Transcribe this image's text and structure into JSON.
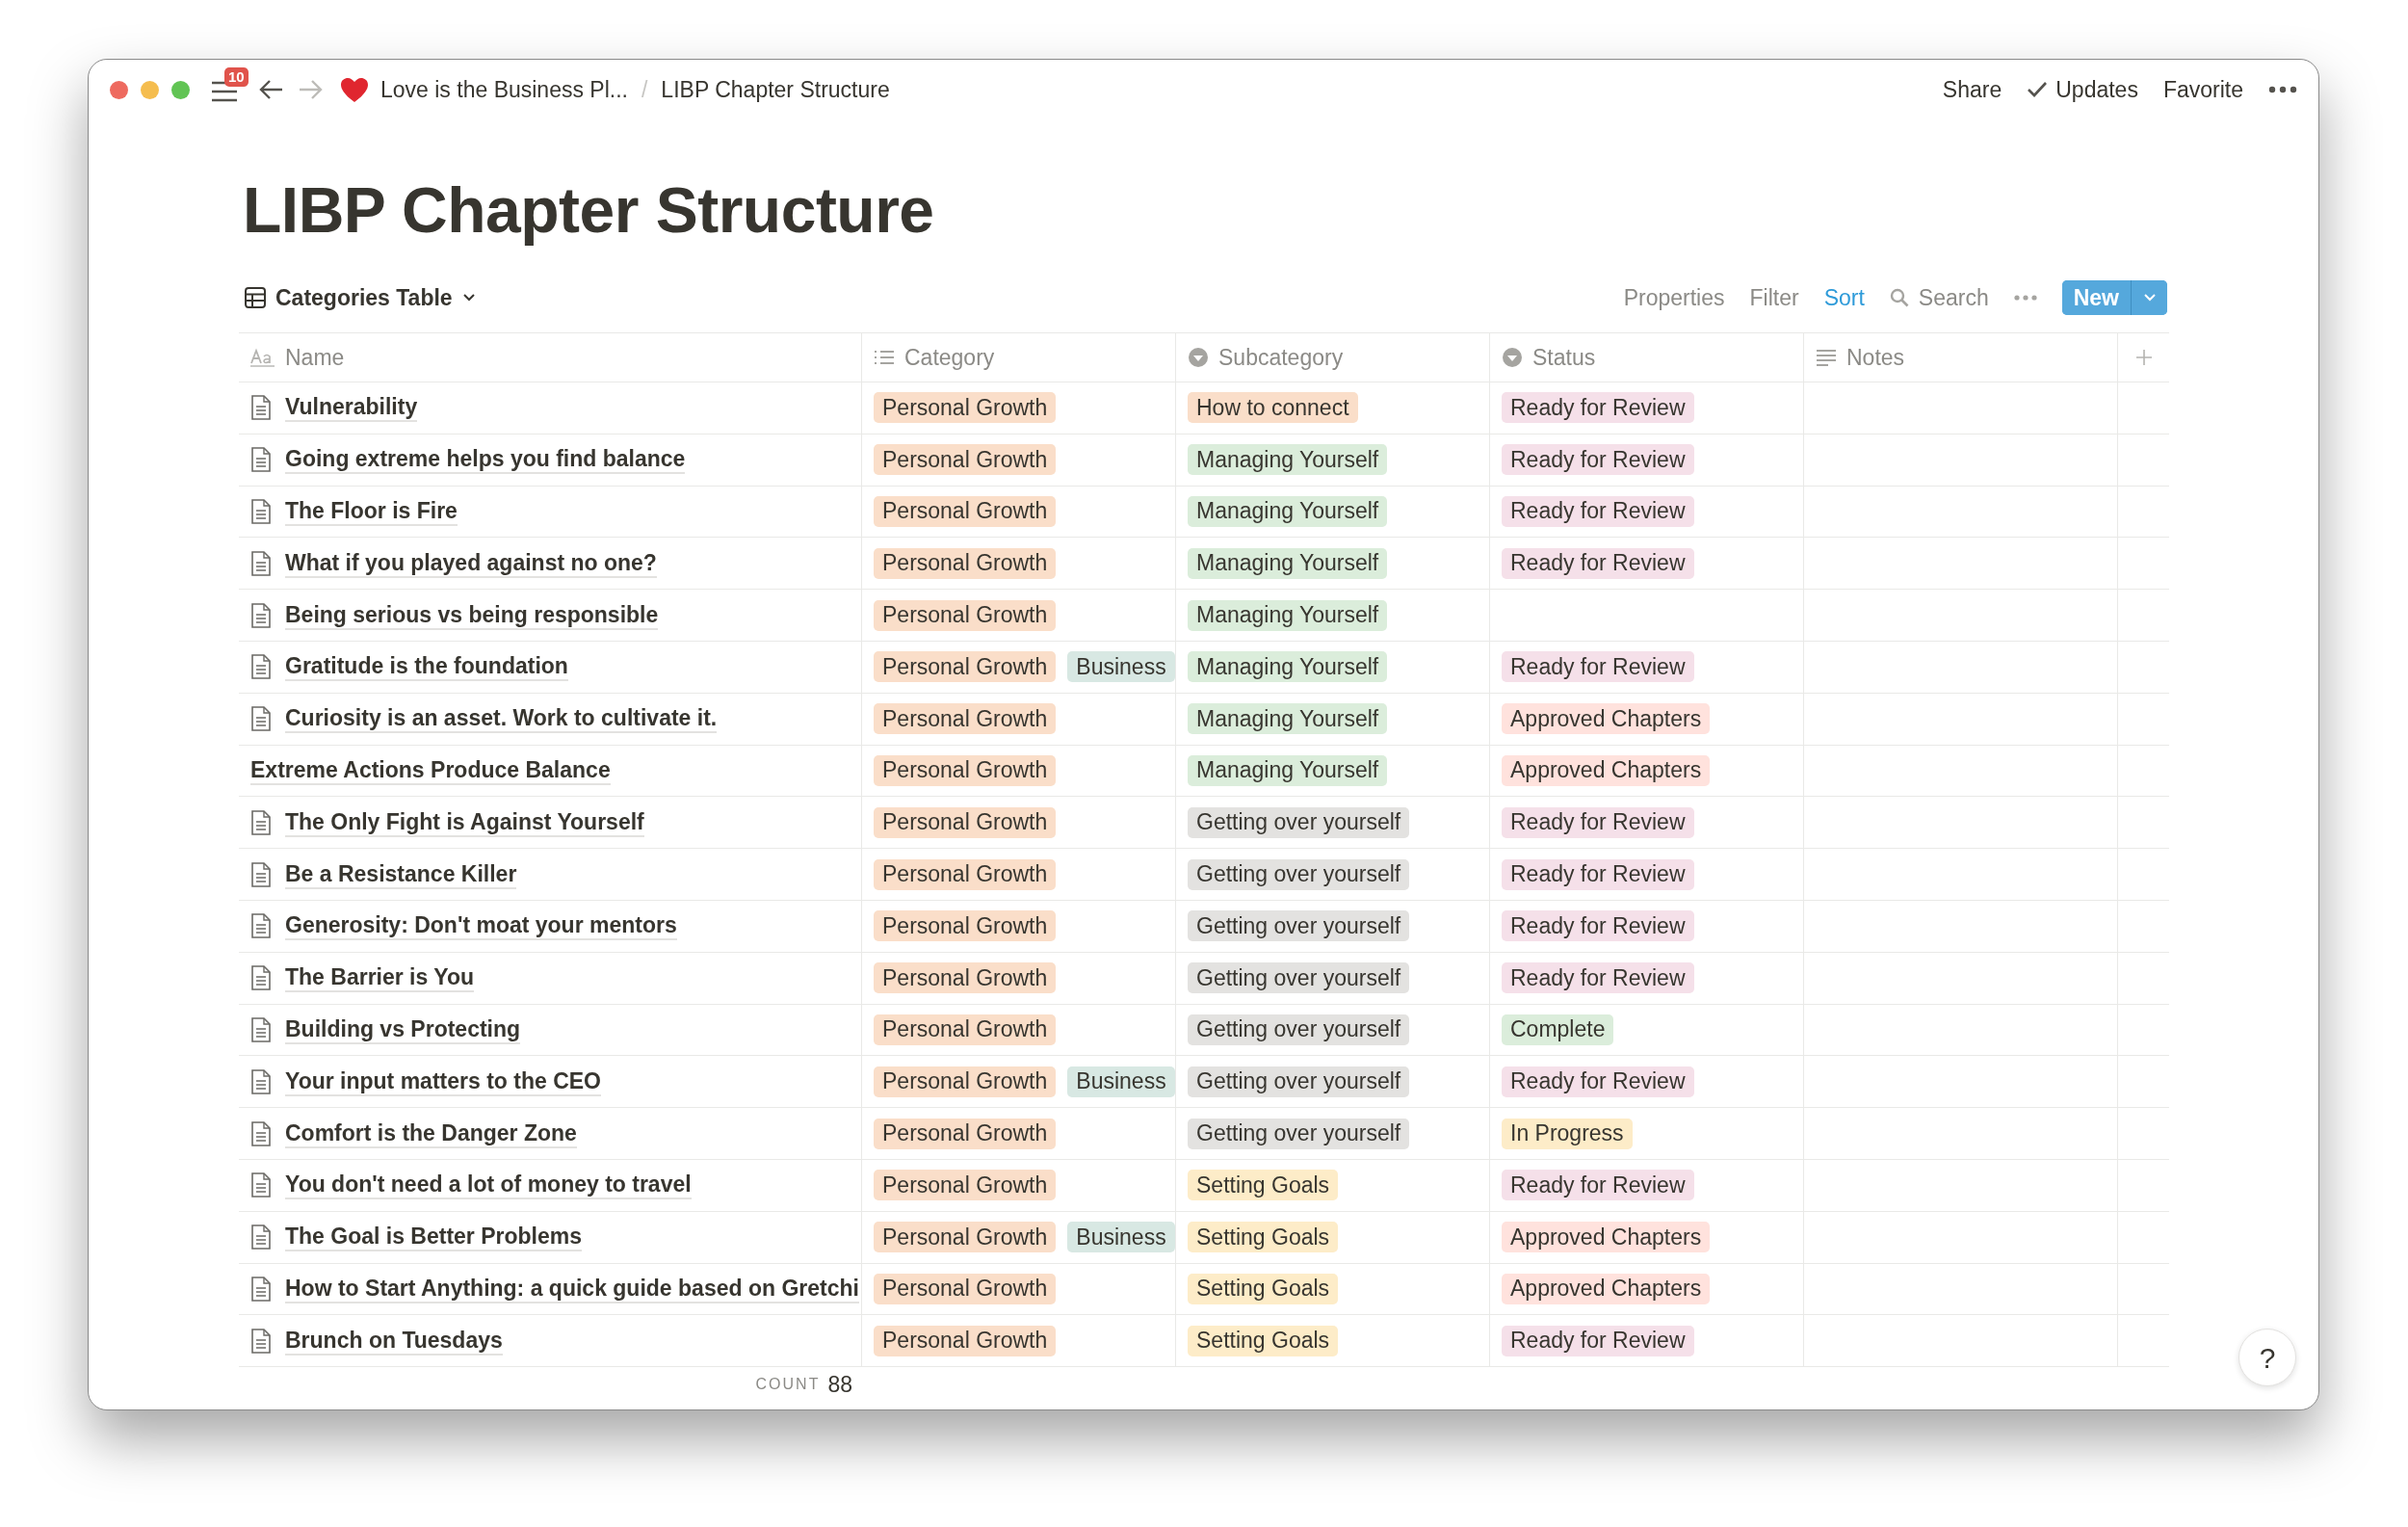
{
  "window": {
    "notification_count": "10",
    "breadcrumb": [
      "Love is the Business Pl...",
      "LIBP Chapter Structure"
    ],
    "breadcrumb_separator": "/",
    "actions": [
      {
        "label": "Share",
        "kind": "plain"
      },
      {
        "label": "Updates",
        "kind": "check"
      },
      {
        "label": "Favorite",
        "kind": "plain"
      }
    ]
  },
  "page": {
    "title": "LIBP Chapter Structure"
  },
  "view": {
    "name": "Categories Table",
    "tools": [
      {
        "label": "Properties",
        "active": false
      },
      {
        "label": "Filter",
        "active": false
      },
      {
        "label": "Sort",
        "active": true
      }
    ],
    "search": "Search",
    "new_button": "New"
  },
  "table": {
    "columns": [
      {
        "label": "Name",
        "kind": "title"
      },
      {
        "label": "Category",
        "kind": "list"
      },
      {
        "label": "Subcategory",
        "kind": "select"
      },
      {
        "label": "Status",
        "kind": "select"
      },
      {
        "label": "Notes",
        "kind": "text"
      }
    ],
    "rows": [
      {
        "name": "Vulnerability",
        "page_icon": true,
        "category": [
          {
            "label": "Personal Growth",
            "color": "#fadec9"
          }
        ],
        "subcategory": {
          "label": "How to connect",
          "color": "#fadec9"
        },
        "status": {
          "label": "Ready for Review",
          "color": "#f5e0e9"
        }
      },
      {
        "name": "Going extreme helps you find balance",
        "page_icon": true,
        "category": [
          {
            "label": "Personal Growth",
            "color": "#fadec9"
          }
        ],
        "subcategory": {
          "label": "Managing Yourself",
          "color": "#dbeddb"
        },
        "status": {
          "label": "Ready for Review",
          "color": "#f5e0e9"
        }
      },
      {
        "name": "The Floor is Fire",
        "page_icon": true,
        "category": [
          {
            "label": "Personal Growth",
            "color": "#fadec9"
          }
        ],
        "subcategory": {
          "label": "Managing Yourself",
          "color": "#dbeddb"
        },
        "status": {
          "label": "Ready for Review",
          "color": "#f5e0e9"
        }
      },
      {
        "name": "What if you played against no one?",
        "page_icon": true,
        "category": [
          {
            "label": "Personal Growth",
            "color": "#fadec9"
          }
        ],
        "subcategory": {
          "label": "Managing Yourself",
          "color": "#dbeddb"
        },
        "status": {
          "label": "Ready for Review",
          "color": "#f5e0e9"
        }
      },
      {
        "name": "Being serious vs being responsible",
        "page_icon": true,
        "category": [
          {
            "label": "Personal Growth",
            "color": "#fadec9"
          }
        ],
        "subcategory": {
          "label": "Managing Yourself",
          "color": "#dbeddb"
        }
      },
      {
        "name": "Gratitude is the foundation",
        "page_icon": true,
        "category": [
          {
            "label": "Personal Growth",
            "color": "#fadec9"
          },
          {
            "label": "Business",
            "color": "#d8e8e3"
          }
        ],
        "subcategory": {
          "label": "Managing Yourself",
          "color": "#dbeddb"
        },
        "status": {
          "label": "Ready for Review",
          "color": "#f5e0e9"
        }
      },
      {
        "name": "Curiosity is an asset. Work to cultivate it.",
        "page_icon": true,
        "category": [
          {
            "label": "Personal Growth",
            "color": "#fadec9"
          }
        ],
        "subcategory": {
          "label": "Managing Yourself",
          "color": "#dbeddb"
        },
        "status": {
          "label": "Approved Chapters",
          "color": "#ffe2dd"
        }
      },
      {
        "name": "Extreme Actions Produce Balance",
        "page_icon": false,
        "category": [
          {
            "label": "Personal Growth",
            "color": "#fadec9"
          }
        ],
        "subcategory": {
          "label": "Managing Yourself",
          "color": "#dbeddb"
        },
        "status": {
          "label": "Approved Chapters",
          "color": "#ffe2dd"
        }
      },
      {
        "name": "The Only Fight is Against Yourself",
        "page_icon": true,
        "category": [
          {
            "label": "Personal Growth",
            "color": "#fadec9"
          }
        ],
        "subcategory": {
          "label": "Getting over yourself",
          "color": "#e3e2e0"
        },
        "status": {
          "label": "Ready for Review",
          "color": "#f5e0e9"
        }
      },
      {
        "name": "Be a Resistance Killer",
        "page_icon": true,
        "category": [
          {
            "label": "Personal Growth",
            "color": "#fadec9"
          }
        ],
        "subcategory": {
          "label": "Getting over yourself",
          "color": "#e3e2e0"
        },
        "status": {
          "label": "Ready for Review",
          "color": "#f5e0e9"
        }
      },
      {
        "name": "Generosity: Don't moat your mentors",
        "page_icon": true,
        "category": [
          {
            "label": "Personal Growth",
            "color": "#fadec9"
          }
        ],
        "subcategory": {
          "label": "Getting over yourself",
          "color": "#e3e2e0"
        },
        "status": {
          "label": "Ready for Review",
          "color": "#f5e0e9"
        }
      },
      {
        "name": "The Barrier is You",
        "page_icon": true,
        "category": [
          {
            "label": "Personal Growth",
            "color": "#fadec9"
          }
        ],
        "subcategory": {
          "label": "Getting over yourself",
          "color": "#e3e2e0"
        },
        "status": {
          "label": "Ready for Review",
          "color": "#f5e0e9"
        }
      },
      {
        "name": "Building vs Protecting",
        "page_icon": true,
        "category": [
          {
            "label": "Personal Growth",
            "color": "#fadec9"
          }
        ],
        "subcategory": {
          "label": "Getting over yourself",
          "color": "#e3e2e0"
        },
        "status": {
          "label": "Complete",
          "color": "#dbeddb"
        }
      },
      {
        "name": "Your input matters to the CEO",
        "page_icon": true,
        "category": [
          {
            "label": "Personal Growth",
            "color": "#fadec9"
          },
          {
            "label": "Business",
            "color": "#d8e8e3"
          }
        ],
        "subcategory": {
          "label": "Getting over yourself",
          "color": "#e3e2e0"
        },
        "status": {
          "label": "Ready for Review",
          "color": "#f5e0e9"
        }
      },
      {
        "name": "Comfort is the Danger Zone",
        "page_icon": true,
        "category": [
          {
            "label": "Personal Growth",
            "color": "#fadec9"
          }
        ],
        "subcategory": {
          "label": "Getting over yourself",
          "color": "#e3e2e0"
        },
        "status": {
          "label": "In Progress",
          "color": "#fdecc8"
        }
      },
      {
        "name": "You don't need a lot of money to travel",
        "page_icon": true,
        "category": [
          {
            "label": "Personal Growth",
            "color": "#fadec9"
          }
        ],
        "subcategory": {
          "label": "Setting Goals",
          "color": "#fdecc8"
        },
        "status": {
          "label": "Ready for Review",
          "color": "#f5e0e9"
        }
      },
      {
        "name": "The Goal is Better Problems",
        "page_icon": true,
        "category": [
          {
            "label": "Personal Growth",
            "color": "#fadec9"
          },
          {
            "label": "Business",
            "color": "#d8e8e3"
          }
        ],
        "subcategory": {
          "label": "Setting Goals",
          "color": "#fdecc8"
        },
        "status": {
          "label": "Approved Chapters",
          "color": "#ffe2dd"
        }
      },
      {
        "name": "How to Start Anything: a quick guide based on Gretchi",
        "page_icon": true,
        "category": [
          {
            "label": "Personal Growth",
            "color": "#fadec9"
          }
        ],
        "subcategory": {
          "label": "Setting Goals",
          "color": "#fdecc8"
        },
        "status": {
          "label": "Approved Chapters",
          "color": "#ffe2dd"
        }
      },
      {
        "name": "Brunch on Tuesdays",
        "page_icon": true,
        "category": [
          {
            "label": "Personal Growth",
            "color": "#fadec9"
          }
        ],
        "subcategory": {
          "label": "Setting Goals",
          "color": "#fdecc8"
        },
        "status": {
          "label": "Ready for Review",
          "color": "#f5e0e9"
        }
      }
    ]
  },
  "footer": {
    "count_label": "COUNT",
    "count": "88"
  },
  "help_button": "?"
}
